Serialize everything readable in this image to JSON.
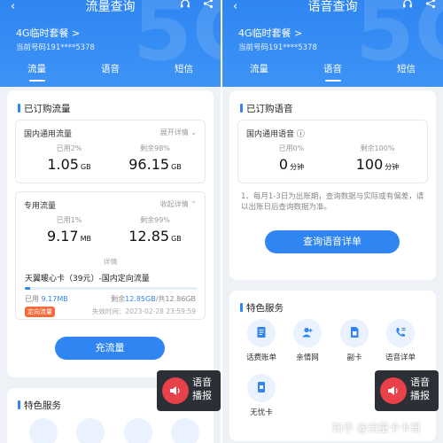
{
  "left": {
    "header": {
      "title": "流量查询",
      "plan": "4G临时套餐 >",
      "phone": "当前号码191****5378",
      "bg_digits": "5G"
    },
    "tabs": [
      {
        "label": "流量",
        "active": true
      },
      {
        "label": "语音",
        "active": false
      },
      {
        "label": "短信",
        "active": false
      }
    ],
    "subscribed": {
      "title": "已订购流量",
      "domestic": {
        "title": "国内通用流量",
        "toggle": "展开详情 ⌄",
        "used_label": "已用2%",
        "used_value": "1.05",
        "used_unit": "GB",
        "remain_label": "剩余98%",
        "remain_value": "96.15",
        "remain_unit": "GB"
      },
      "dedicated": {
        "title": "专用流量",
        "toggle": "收起详情 ⌃",
        "used_label": "已用1%",
        "used_value": "9.17",
        "used_unit": "MB",
        "remain_label": "剩余99%",
        "remain_value": "12.85",
        "remain_unit": "GB",
        "detail_label": "详情",
        "package_name": "天翼暖心卡（39元）-国内定向流量",
        "used_prefix": "已用 ",
        "used_amount": "9.17MB",
        "remain_prefix": "剩余",
        "remain_amount": "12.85GB",
        "remain_total": "/共12.86GB",
        "progress": 0.01,
        "badge": "定向流量",
        "expire": "失效时间：2023-02-28 23:59:59"
      }
    },
    "recharge_button": "充流量",
    "services_title": "特色服务"
  },
  "right": {
    "header": {
      "title": "语音查询",
      "plan": "4G临时套餐 >",
      "phone": "当前号码191****5378",
      "bg_digits": "5G"
    },
    "tabs": [
      {
        "label": "流量",
        "active": false
      },
      {
        "label": "语音",
        "active": true
      },
      {
        "label": "短信",
        "active": false
      }
    ],
    "subscribed": {
      "title": "已订购语音",
      "domestic": {
        "title": "国内通用语音 ⓘ",
        "used_label": "已用0%",
        "used_value": "0",
        "used_unit": "分钟",
        "remain_label": "剩余100%",
        "remain_value": "100",
        "remain_unit": "分钟"
      },
      "note": "1、每月1-3日为出账期，查询数据与实际或有偏差，请以出账日后查询数据为准。"
    },
    "query_button": "查询语音详单",
    "services": {
      "title": "特色服务",
      "items": [
        {
          "label": "话费账单",
          "icon": "bill-icon"
        },
        {
          "label": "亲情网",
          "icon": "family-icon"
        },
        {
          "label": "副卡",
          "icon": "sim-card-icon"
        },
        {
          "label": "语音详单",
          "icon": "phone-list-icon"
        },
        {
          "label": "无忧卡",
          "icon": "worry-free-card-icon"
        }
      ]
    }
  },
  "voice_float": {
    "line1": "语音",
    "line2": "播报"
  },
  "watermark": "知乎 @流量卡卡哥",
  "colors": {
    "primary": "#2f86f2",
    "accent_red": "#e8414a",
    "badge_orange": "#f56a3b"
  }
}
